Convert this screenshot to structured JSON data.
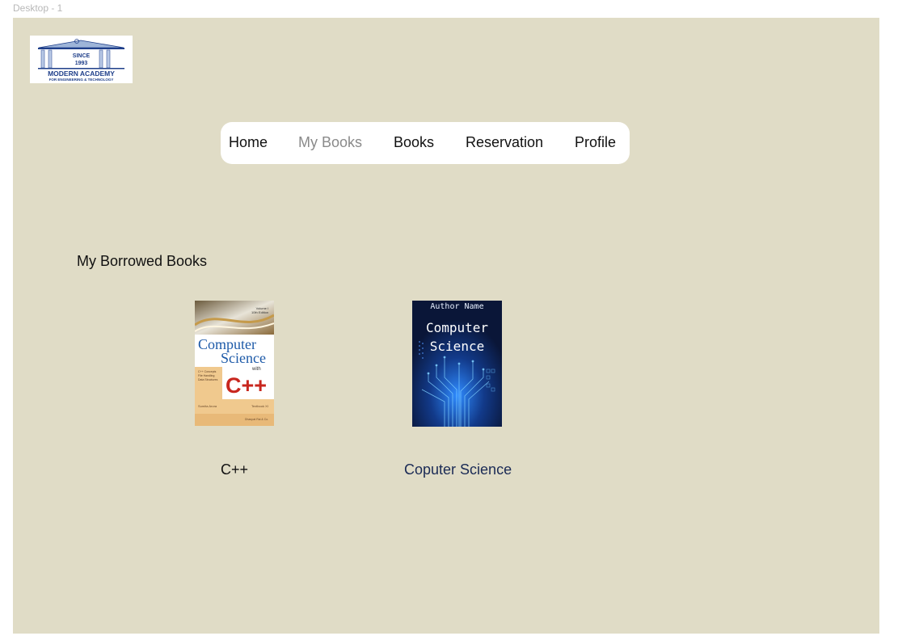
{
  "frame": {
    "label": "Desktop - 1"
  },
  "colors": {
    "canvas_background": "#e0dcc6",
    "navbar_background": "#ffffff",
    "nav_active": "#8a8a8a",
    "nav_text": "#111111",
    "second_book_label": "#1a2a55"
  },
  "logo": {
    "since": "SINCE",
    "year": "1993",
    "name": "MODERN ACADEMY",
    "tagline": "FOR ENGINEERING & TECHNOLOGY"
  },
  "nav": {
    "items": [
      {
        "label": "Home",
        "active": false
      },
      {
        "label": "My Books",
        "active": true
      },
      {
        "label": "Books",
        "active": false
      },
      {
        "label": "Reservation",
        "active": false
      },
      {
        "label": "Profile",
        "active": false
      }
    ]
  },
  "section": {
    "title": "My Borrowed Books"
  },
  "books": [
    {
      "label": "C++",
      "cover": {
        "title_line1": "Computer",
        "title_line2": "Science",
        "with": "with",
        "logo": "C++",
        "volume": "Volume I",
        "edition": "10th Edition",
        "bullets": [
          "C++ Concepts",
          "File Handling",
          "Data Structures"
        ],
        "author": "Sumita Arora",
        "textbook": "Textbook XI",
        "publisher": "Dhanpat Rai & Co."
      }
    },
    {
      "label": "Coputer Science",
      "cover": {
        "author_name": "Author Name",
        "title_line1": "Computer",
        "title_line2": "Science"
      }
    }
  ]
}
